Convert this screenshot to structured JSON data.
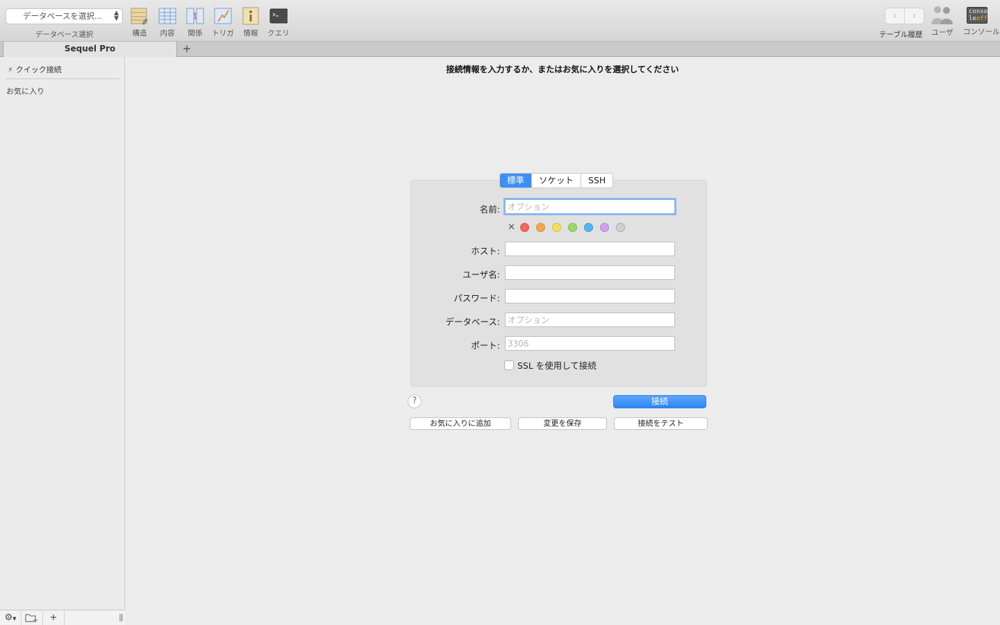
{
  "toolbar": {
    "db_select_placeholder": "データベースを選択...",
    "db_select_caption": "データベース選択",
    "tools": [
      {
        "label": "構造",
        "icon": "structure-icon"
      },
      {
        "label": "内容",
        "icon": "content-icon"
      },
      {
        "label": "関係",
        "icon": "relations-icon"
      },
      {
        "label": "トリガ",
        "icon": "triggers-icon"
      },
      {
        "label": "情報",
        "icon": "info-icon"
      },
      {
        "label": "クエリ",
        "icon": "query-icon"
      }
    ],
    "history_label": "テーブル履歴",
    "users_label": "ユーザ",
    "console_label": "コンソール",
    "console_icon_text_1": "conso",
    "console_icon_text_2a": "le",
    "console_icon_text_2b": "off"
  },
  "tabs": {
    "active": "Sequel Pro",
    "new_tab": "+"
  },
  "sidebar": {
    "quick_connect": "クイック接続",
    "favorites_header": "お気に入り"
  },
  "main": {
    "instruction": "接続情報を入力するか、またはお気に入りを選択してください",
    "connection_types": [
      "標準",
      "ソケット",
      "SSH"
    ],
    "active_type": "標準",
    "fields": {
      "name_label": "名前:",
      "name_placeholder": "オプション",
      "host_label": "ホスト:",
      "host_value": "",
      "user_label": "ユーザ名:",
      "user_value": "",
      "password_label": "パスワード:",
      "password_value": "",
      "database_label": "データベース:",
      "database_placeholder": "オプション",
      "port_label": "ポート:",
      "port_placeholder": "3306"
    },
    "color_labels": [
      "#f0685e",
      "#f5a54a",
      "#f7dd5e",
      "#9ada6a",
      "#5ab4f2",
      "#d39ff0",
      "#cfcfcf"
    ],
    "ssl_label": "SSL を使用して接続",
    "ssl_checked": false,
    "help": "?",
    "connect_button": "接続",
    "add_favorite_button": "お気に入りに追加",
    "save_changes_button": "変更を保存",
    "test_connection_button": "接続をテスト"
  }
}
